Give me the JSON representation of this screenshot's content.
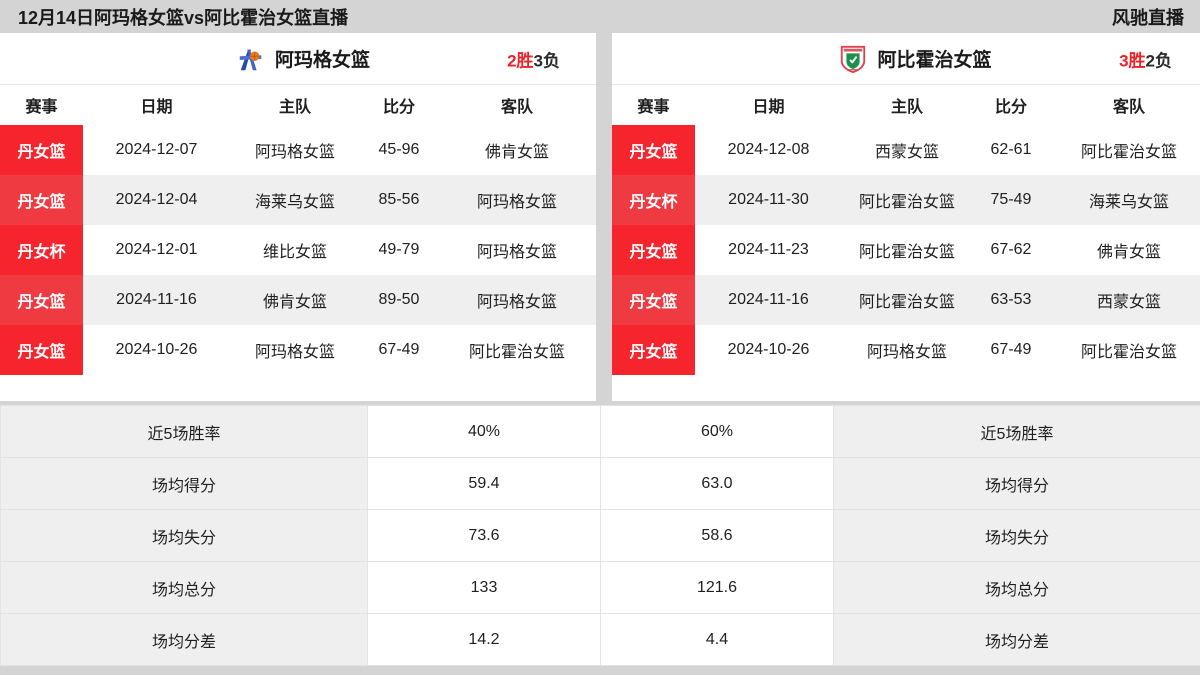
{
  "topbar": {
    "title": "12月14日阿玛格女篮vs阿比霍治女篮直播",
    "brand": "风驰直播"
  },
  "colors": {
    "accent_red": "#f6242d",
    "accent_red_alt": "#f03a41",
    "page_bg": "#d4d4d4",
    "row_alt": "#efefef",
    "text": "#1f1f1f"
  },
  "left_panel": {
    "team_name": "阿玛格女篮",
    "logo_icon": "amager-team-logo",
    "record_wins": "2胜",
    "record_losses": "3负",
    "headers": [
      "赛事",
      "日期",
      "主队",
      "比分",
      "客队"
    ],
    "rows": [
      {
        "league": "丹女篮",
        "date": "2024-12-07",
        "home": "阿玛格女篮",
        "score": "45-96",
        "away": "佛肯女篮"
      },
      {
        "league": "丹女篮",
        "date": "2024-12-04",
        "home": "海莱乌女篮",
        "score": "85-56",
        "away": "阿玛格女篮"
      },
      {
        "league": "丹女杯",
        "date": "2024-12-01",
        "home": "维比女篮",
        "score": "49-79",
        "away": "阿玛格女篮"
      },
      {
        "league": "丹女篮",
        "date": "2024-11-16",
        "home": "佛肯女篮",
        "score": "89-50",
        "away": "阿玛格女篮"
      },
      {
        "league": "丹女篮",
        "date": "2024-10-26",
        "home": "阿玛格女篮",
        "score": "67-49",
        "away": "阿比霍治女篮"
      }
    ]
  },
  "right_panel": {
    "team_name": "阿比霍治女篮",
    "logo_icon": "abildhoj-team-logo",
    "record_wins": "3胜",
    "record_losses": "2负",
    "headers": [
      "赛事",
      "日期",
      "主队",
      "比分",
      "客队"
    ],
    "rows": [
      {
        "league": "丹女篮",
        "date": "2024-12-08",
        "home": "西蒙女篮",
        "score": "62-61",
        "away": "阿比霍治女篮"
      },
      {
        "league": "丹女杯",
        "date": "2024-11-30",
        "home": "阿比霍治女篮",
        "score": "75-49",
        "away": "海莱乌女篮"
      },
      {
        "league": "丹女篮",
        "date": "2024-11-23",
        "home": "阿比霍治女篮",
        "score": "67-62",
        "away": "佛肯女篮"
      },
      {
        "league": "丹女篮",
        "date": "2024-11-16",
        "home": "阿比霍治女篮",
        "score": "63-53",
        "away": "西蒙女篮"
      },
      {
        "league": "丹女篮",
        "date": "2024-10-26",
        "home": "阿玛格女篮",
        "score": "67-49",
        "away": "阿比霍治女篮"
      }
    ]
  },
  "stats": {
    "rows": [
      {
        "left_label": "近5场胜率",
        "left_value": "40%",
        "right_value": "60%",
        "right_label": "近5场胜率"
      },
      {
        "left_label": "场均得分",
        "left_value": "59.4",
        "right_value": "63.0",
        "right_label": "场均得分"
      },
      {
        "left_label": "场均失分",
        "left_value": "73.6",
        "right_value": "58.6",
        "right_label": "场均失分"
      },
      {
        "left_label": "场均总分",
        "left_value": "133",
        "right_value": "121.6",
        "right_label": "场均总分"
      },
      {
        "left_label": "场均分差",
        "left_value": "14.2",
        "right_value": "4.4",
        "right_label": "场均分差"
      }
    ]
  }
}
